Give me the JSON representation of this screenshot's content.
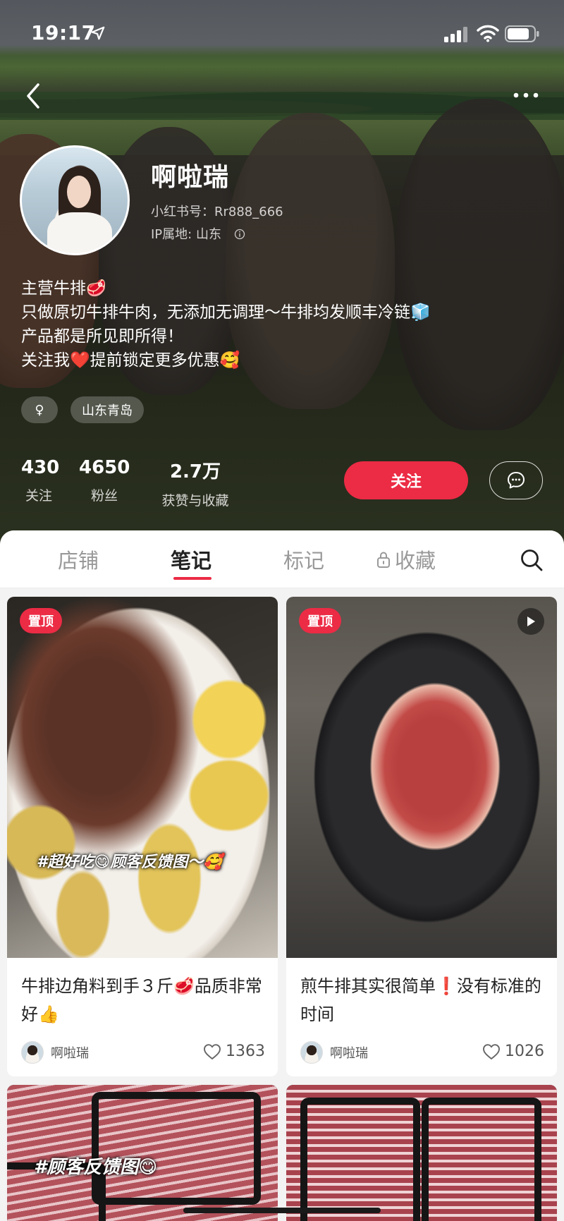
{
  "status_bar": {
    "time": "19:17"
  },
  "profile": {
    "username": "啊啦瑞",
    "redbook_id": "小红书号：Rr888_666",
    "ip_location": "IP属地: 山东",
    "bio_lines": [
      "主营牛排🥩",
      "只做原切牛排牛肉，无添加无调理～牛排均发顺丰冷链🧊",
      "产品都是所见即所得！",
      "关注我❤️提前锁定更多优惠🥰"
    ],
    "tags": {
      "gender": "♀",
      "region": "山东青岛"
    },
    "stats": [
      {
        "value": "430",
        "label": "关注"
      },
      {
        "value": "4650",
        "label": "粉丝"
      },
      {
        "value": "2.7万",
        "label": "获赞与收藏"
      }
    ],
    "follow_label": "关注"
  },
  "tabs": [
    {
      "label": "店铺",
      "active": false
    },
    {
      "label": "笔记",
      "active": true
    },
    {
      "label": "标记",
      "active": false
    },
    {
      "label": "收藏",
      "active": false,
      "locked": true
    }
  ],
  "notes": [
    {
      "pinned_label": "置顶",
      "cover_caption": "#超好吃😋顾客反馈图～🥰",
      "title": "牛排边角料到手３斤🥩品质非常好👍",
      "author": "啊啦瑞",
      "likes": "1363"
    },
    {
      "pinned_label": "置顶",
      "is_video": true,
      "title": "煎牛排其实很简单❗️没有标准的时间",
      "author": "啊啦瑞",
      "likes": "1026"
    },
    {
      "cover_caption": "#顾客反馈图😋"
    },
    {}
  ],
  "colors": {
    "accent": "#ec2b45",
    "panel_bg": "#f3f3f3"
  }
}
